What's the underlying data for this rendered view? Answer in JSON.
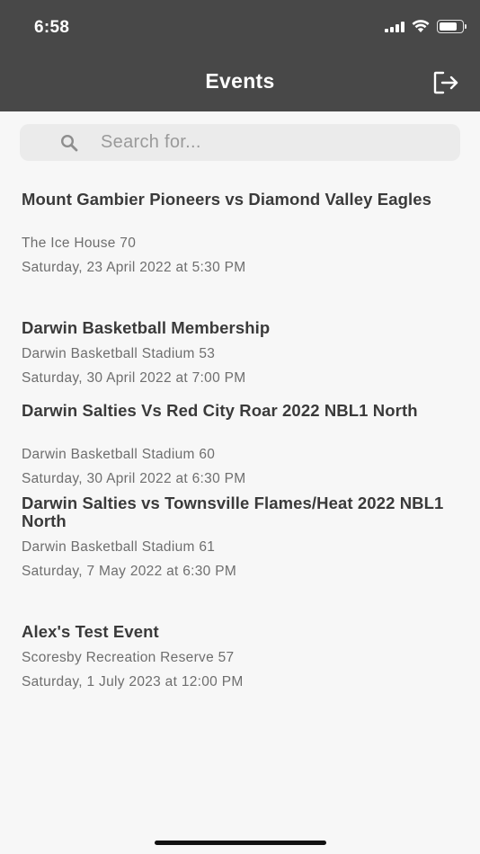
{
  "status_bar": {
    "time": "6:58"
  },
  "header": {
    "title": "Events"
  },
  "search": {
    "placeholder": "Search for..."
  },
  "events": [
    {
      "title": "Mount Gambier Pioneers vs Diamond Valley Eagles",
      "venue": "The Ice House 70",
      "date": "Saturday, 23 April 2022 at 5:30 PM"
    },
    {
      "title": "Darwin Basketball Membership",
      "venue": "Darwin Basketball Stadium 53",
      "date": "Saturday, 30 April 2022 at 7:00 PM"
    },
    {
      "title": "Darwin Salties Vs Red City Roar 2022 NBL1 North",
      "venue": "Darwin Basketball Stadium 60",
      "date": "Saturday, 30 April 2022 at 6:30 PM"
    },
    {
      "title": "Darwin Salties vs Townsville Flames/Heat 2022 NBL1 North",
      "venue": "Darwin Basketball Stadium 61",
      "date": "Saturday, 7 May 2022 at 6:30 PM"
    },
    {
      "title": "Alex's Test Event",
      "venue": "Scoresby Recreation Reserve 57",
      "date": "Saturday, 1 July 2023 at 12:00 PM"
    }
  ]
}
